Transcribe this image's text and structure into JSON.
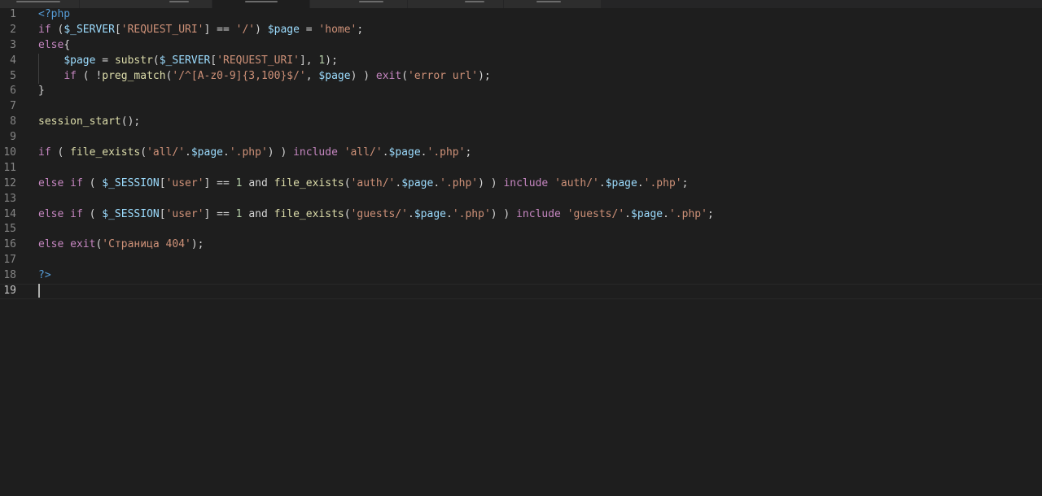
{
  "editor": {
    "lines": [
      {
        "number": "1",
        "tokens": [
          {
            "t": "<?php",
            "c": "t"
          }
        ]
      },
      {
        "number": "2",
        "tokens": [
          {
            "t": "if",
            "c": "k"
          },
          {
            "t": " (",
            "c": "p"
          },
          {
            "t": "$_SERVER",
            "c": "v"
          },
          {
            "t": "[",
            "c": "p"
          },
          {
            "t": "'REQUEST_URI'",
            "c": "s"
          },
          {
            "t": "] == ",
            "c": "p"
          },
          {
            "t": "'/'",
            "c": "s"
          },
          {
            "t": ") ",
            "c": "p"
          },
          {
            "t": "$page",
            "c": "v"
          },
          {
            "t": " = ",
            "c": "p"
          },
          {
            "t": "'home'",
            "c": "s"
          },
          {
            "t": ";",
            "c": "p"
          }
        ]
      },
      {
        "number": "3",
        "tokens": [
          {
            "t": "else",
            "c": "k"
          },
          {
            "t": "{",
            "c": "p"
          }
        ]
      },
      {
        "number": "4",
        "tokens": [
          {
            "t": "    ",
            "c": "p"
          },
          {
            "t": "$page",
            "c": "v"
          },
          {
            "t": " = ",
            "c": "p"
          },
          {
            "t": "substr",
            "c": "f"
          },
          {
            "t": "(",
            "c": "p"
          },
          {
            "t": "$_SERVER",
            "c": "v"
          },
          {
            "t": "[",
            "c": "p"
          },
          {
            "t": "'REQUEST_URI'",
            "c": "s"
          },
          {
            "t": "], ",
            "c": "p"
          },
          {
            "t": "1",
            "c": "n"
          },
          {
            "t": ");",
            "c": "p"
          }
        ]
      },
      {
        "number": "5",
        "tokens": [
          {
            "t": "    ",
            "c": "p"
          },
          {
            "t": "if",
            "c": "k"
          },
          {
            "t": " ( !",
            "c": "p"
          },
          {
            "t": "preg_match",
            "c": "f"
          },
          {
            "t": "(",
            "c": "p"
          },
          {
            "t": "'/^[A-z0-9]{3,100}$/'",
            "c": "s"
          },
          {
            "t": ", ",
            "c": "p"
          },
          {
            "t": "$page",
            "c": "v"
          },
          {
            "t": ") ) ",
            "c": "p"
          },
          {
            "t": "exit",
            "c": "k"
          },
          {
            "t": "(",
            "c": "p"
          },
          {
            "t": "'error url'",
            "c": "s"
          },
          {
            "t": ");",
            "c": "p"
          }
        ]
      },
      {
        "number": "6",
        "tokens": [
          {
            "t": "}",
            "c": "p"
          }
        ]
      },
      {
        "number": "7",
        "tokens": []
      },
      {
        "number": "8",
        "tokens": [
          {
            "t": "session_start",
            "c": "f"
          },
          {
            "t": "();",
            "c": "p"
          }
        ]
      },
      {
        "number": "9",
        "tokens": []
      },
      {
        "number": "10",
        "tokens": [
          {
            "t": "if",
            "c": "k"
          },
          {
            "t": " ( ",
            "c": "p"
          },
          {
            "t": "file_exists",
            "c": "f"
          },
          {
            "t": "(",
            "c": "p"
          },
          {
            "t": "'all/'",
            "c": "s"
          },
          {
            "t": ".",
            "c": "p"
          },
          {
            "t": "$page",
            "c": "v"
          },
          {
            "t": ".",
            "c": "p"
          },
          {
            "t": "'.php'",
            "c": "s"
          },
          {
            "t": ") ) ",
            "c": "p"
          },
          {
            "t": "include",
            "c": "k"
          },
          {
            "t": " ",
            "c": "p"
          },
          {
            "t": "'all/'",
            "c": "s"
          },
          {
            "t": ".",
            "c": "p"
          },
          {
            "t": "$page",
            "c": "v"
          },
          {
            "t": ".",
            "c": "p"
          },
          {
            "t": "'.php'",
            "c": "s"
          },
          {
            "t": ";",
            "c": "p"
          }
        ]
      },
      {
        "number": "11",
        "tokens": []
      },
      {
        "number": "12",
        "tokens": [
          {
            "t": "else",
            "c": "k"
          },
          {
            "t": " ",
            "c": "p"
          },
          {
            "t": "if",
            "c": "k"
          },
          {
            "t": " ( ",
            "c": "p"
          },
          {
            "t": "$_SESSION",
            "c": "v"
          },
          {
            "t": "[",
            "c": "p"
          },
          {
            "t": "'user'",
            "c": "s"
          },
          {
            "t": "] == ",
            "c": "p"
          },
          {
            "t": "1",
            "c": "n"
          },
          {
            "t": " and ",
            "c": "p"
          },
          {
            "t": "file_exists",
            "c": "f"
          },
          {
            "t": "(",
            "c": "p"
          },
          {
            "t": "'auth/'",
            "c": "s"
          },
          {
            "t": ".",
            "c": "p"
          },
          {
            "t": "$page",
            "c": "v"
          },
          {
            "t": ".",
            "c": "p"
          },
          {
            "t": "'.php'",
            "c": "s"
          },
          {
            "t": ") ) ",
            "c": "p"
          },
          {
            "t": "include",
            "c": "k"
          },
          {
            "t": " ",
            "c": "p"
          },
          {
            "t": "'auth/'",
            "c": "s"
          },
          {
            "t": ".",
            "c": "p"
          },
          {
            "t": "$page",
            "c": "v"
          },
          {
            "t": ".",
            "c": "p"
          },
          {
            "t": "'.php'",
            "c": "s"
          },
          {
            "t": ";",
            "c": "p"
          }
        ]
      },
      {
        "number": "13",
        "tokens": []
      },
      {
        "number": "14",
        "tokens": [
          {
            "t": "else",
            "c": "k"
          },
          {
            "t": " ",
            "c": "p"
          },
          {
            "t": "if",
            "c": "k"
          },
          {
            "t": " ( ",
            "c": "p"
          },
          {
            "t": "$_SESSION",
            "c": "v"
          },
          {
            "t": "[",
            "c": "p"
          },
          {
            "t": "'user'",
            "c": "s"
          },
          {
            "t": "] == ",
            "c": "p"
          },
          {
            "t": "1",
            "c": "n"
          },
          {
            "t": " and ",
            "c": "p"
          },
          {
            "t": "file_exists",
            "c": "f"
          },
          {
            "t": "(",
            "c": "p"
          },
          {
            "t": "'guests/'",
            "c": "s"
          },
          {
            "t": ".",
            "c": "p"
          },
          {
            "t": "$page",
            "c": "v"
          },
          {
            "t": ".",
            "c": "p"
          },
          {
            "t": "'.php'",
            "c": "s"
          },
          {
            "t": ") ) ",
            "c": "p"
          },
          {
            "t": "include",
            "c": "k"
          },
          {
            "t": " ",
            "c": "p"
          },
          {
            "t": "'guests/'",
            "c": "s"
          },
          {
            "t": ".",
            "c": "p"
          },
          {
            "t": "$page",
            "c": "v"
          },
          {
            "t": ".",
            "c": "p"
          },
          {
            "t": "'.php'",
            "c": "s"
          },
          {
            "t": ";",
            "c": "p"
          }
        ]
      },
      {
        "number": "15",
        "tokens": []
      },
      {
        "number": "16",
        "tokens": [
          {
            "t": "else",
            "c": "k"
          },
          {
            "t": " ",
            "c": "p"
          },
          {
            "t": "exit",
            "c": "k"
          },
          {
            "t": "(",
            "c": "p"
          },
          {
            "t": "'Страница 404'",
            "c": "s"
          },
          {
            "t": ");",
            "c": "p"
          }
        ]
      },
      {
        "number": "17",
        "tokens": []
      },
      {
        "number": "18",
        "tokens": [
          {
            "t": "?>",
            "c": "t"
          }
        ]
      },
      {
        "number": "19",
        "tokens": []
      }
    ],
    "current_line": "19",
    "colors": {
      "background": "#1e1e1e",
      "keyword": "#c586c0",
      "function": "#dcdcaa",
      "variable": "#9cdcfe",
      "string": "#ce9178",
      "number": "#b5cea8",
      "tag": "#569cd6",
      "line_number": "#858585"
    }
  }
}
